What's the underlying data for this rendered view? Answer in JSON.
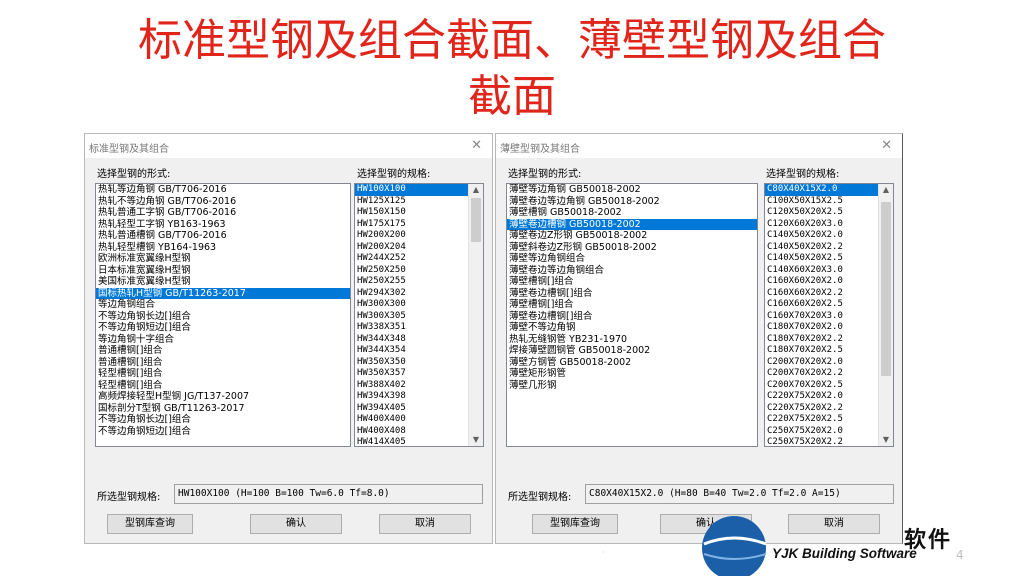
{
  "slide": {
    "title_line1": "标准型钢及组合截面、薄壁型钢及组合",
    "title_line2": "截面",
    "page_number": "4",
    "logo_cn": "软件",
    "logo_en": "YJK Building Software",
    "colors": {
      "title": "#e1251b",
      "selection": "#0078d7",
      "logo_blue": "#1a5fa8"
    }
  },
  "dialog1": {
    "title": "标准型钢及其组合",
    "form_label": "选择型钢的形式:",
    "spec_label": "选择型钢的规格:",
    "forms": [
      "热轧等边角钢  GB/T706-2016",
      "热轧不等边角钢  GB/T706-2016",
      "热轧普通工字钢  GB/T706-2016",
      "热轧轻型工字钢  YB163-1963",
      "热轧普通槽钢  GB/T706-2016",
      "热轧轻型槽钢  YB164-1963",
      "欧洲标准宽翼缘H型钢",
      "日本标准宽翼缘H型钢",
      "美国标准宽翼缘H型钢",
      "国标热轧H型钢  GB/T11263-2017",
      "等边角钢组合",
      "不等边角钢长边[]组合",
      "不等边角钢短边[]组合",
      "等边角钢十字组合",
      "普通槽钢[]组合",
      "普通槽钢[]组合",
      "轻型槽钢[]组合",
      "轻型槽钢[]组合",
      "高频焊接轻型H型钢  JG/T137-2007",
      "国标剖分T型钢  GB/T11263-2017",
      "不等边角钢长边[]组合",
      "不等边角钢短边[]组合"
    ],
    "forms_selected_index": 9,
    "specs": [
      "HW100X100",
      "HW125X125",
      "HW150X150",
      "HW175X175",
      "HW200X200",
      "HW200X204",
      "HW244X252",
      "HW250X250",
      "HW250X255",
      "HW294X302",
      "HW300X300",
      "HW300X305",
      "HW338X351",
      "HW344X348",
      "HW344X354",
      "HW350X350",
      "HW350X357",
      "HW388X402",
      "HW394X398",
      "HW394X405",
      "HW400X400",
      "HW400X408",
      "HW414X405"
    ],
    "specs_selected_index": 0,
    "selected_spec_label": "所选型钢规格:",
    "selected_spec_value": "HW100X100   (H=100  B=100  Tw=6.0  Tf=8.0)",
    "buttons": {
      "query": "型钢库查询",
      "ok": "确认",
      "cancel": "取消"
    }
  },
  "dialog2": {
    "title": "薄壁型钢及其组合",
    "form_label": "选择型钢的形式:",
    "spec_label": "选择型钢的规格:",
    "forms": [
      "薄壁等边角钢  GB50018-2002",
      "薄壁卷边等边角钢  GB50018-2002",
      "薄壁槽钢  GB50018-2002",
      "薄壁卷边槽钢  GB50018-2002",
      "薄壁卷边Z形钢  GB50018-2002",
      "薄壁斜卷边Z形钢  GB50018-2002",
      "薄壁等边角钢组合",
      "薄壁卷边等边角钢组合",
      "薄壁槽钢[]组合",
      "薄壁卷边槽钢[]组合",
      "薄壁槽钢[]组合",
      "薄壁卷边槽钢[]组合",
      "薄壁不等边角钢",
      "热轧无缝钢管  YB231-1970",
      "焊接薄壁圆钢管  GB50018-2002",
      "薄壁方钢管  GB50018-2002",
      "薄壁矩形钢管",
      "薄壁几形钢"
    ],
    "forms_selected_index": 3,
    "specs": [
      "C80X40X15X2.0",
      "C100X50X15X2.5",
      "C120X50X20X2.5",
      "C120X60X20X3.0",
      "C140X50X20X2.0",
      "C140X50X20X2.2",
      "C140X50X20X2.5",
      "C140X60X20X3.0",
      "C160X60X20X2.0",
      "C160X60X20X2.2",
      "C160X60X20X2.5",
      "C160X70X20X3.0",
      "C180X70X20X2.0",
      "C180X70X20X2.2",
      "C180X70X20X2.5",
      "C200X70X20X2.0",
      "C200X70X20X2.2",
      "C200X70X20X2.5",
      "C220X75X20X2.0",
      "C220X75X20X2.2",
      "C220X75X20X2.5",
      "C250X75X20X2.0",
      "C250X75X20X2.2"
    ],
    "specs_selected_index": 0,
    "selected_spec_label": "所选型钢规格:",
    "selected_spec_value": "C80X40X15X2.0   (H=80  B=40  Tw=2.0  Tf=2.0  A=15)",
    "buttons": {
      "query": "型钢库查询",
      "ok": "确认",
      "cancel": "取消"
    }
  }
}
